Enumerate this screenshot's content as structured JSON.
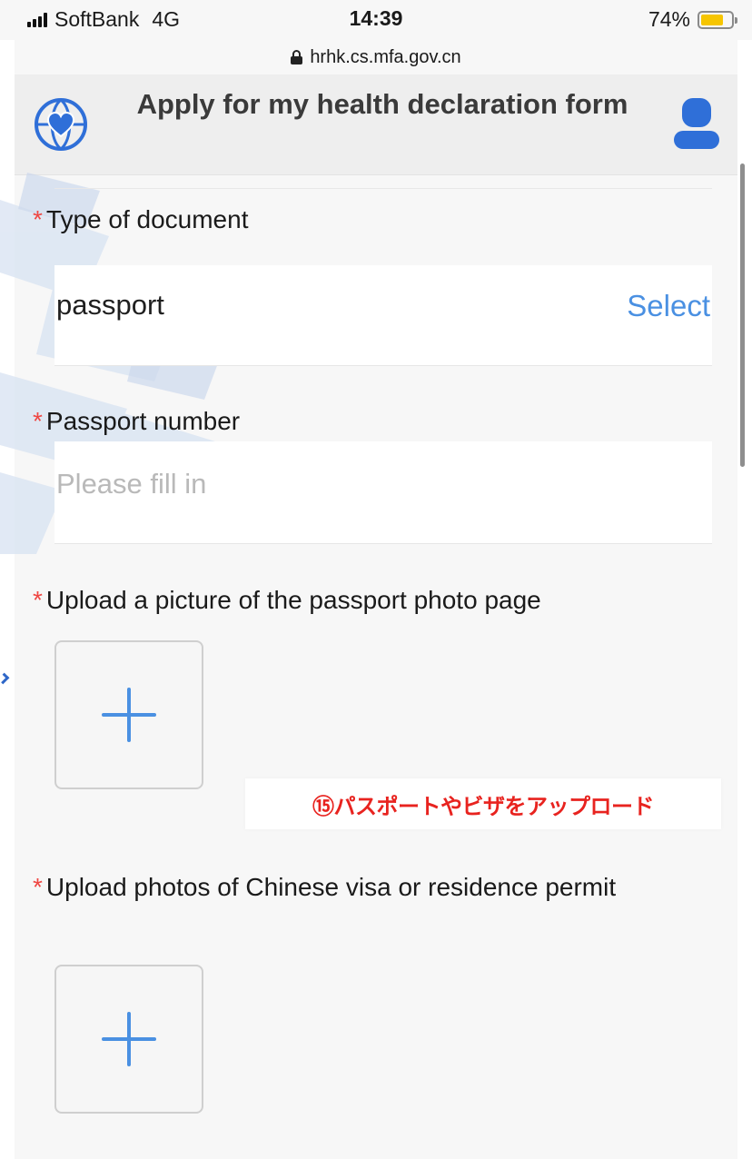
{
  "status_bar": {
    "carrier": "SoftBank",
    "network": "4G",
    "time": "14:39",
    "battery_percent": "74%",
    "battery_level": 0.74
  },
  "browser": {
    "url": "hrhk.cs.mfa.gov.cn"
  },
  "header": {
    "title": "Apply for my health declaration form",
    "left_icon": "globe-heart-icon",
    "right_icon": "user-profile-icon"
  },
  "form": {
    "required_mark": "*",
    "document_type": {
      "label": "Type of document",
      "value": "passport",
      "action": "Select"
    },
    "passport_number": {
      "label": "Passport number",
      "placeholder": "Please fill in",
      "value": ""
    },
    "passport_photo": {
      "label": "Upload a picture of the passport photo page"
    },
    "visa_photo": {
      "label": "Upload photos of Chinese visa or residence permit"
    }
  },
  "annotation": {
    "text": "⑮パスポートやビザをアップロード"
  },
  "colors": {
    "accent": "#4a90e2",
    "required": "#ef4743",
    "annotation": "#e8231f",
    "header_bg": "#eeeeee"
  }
}
